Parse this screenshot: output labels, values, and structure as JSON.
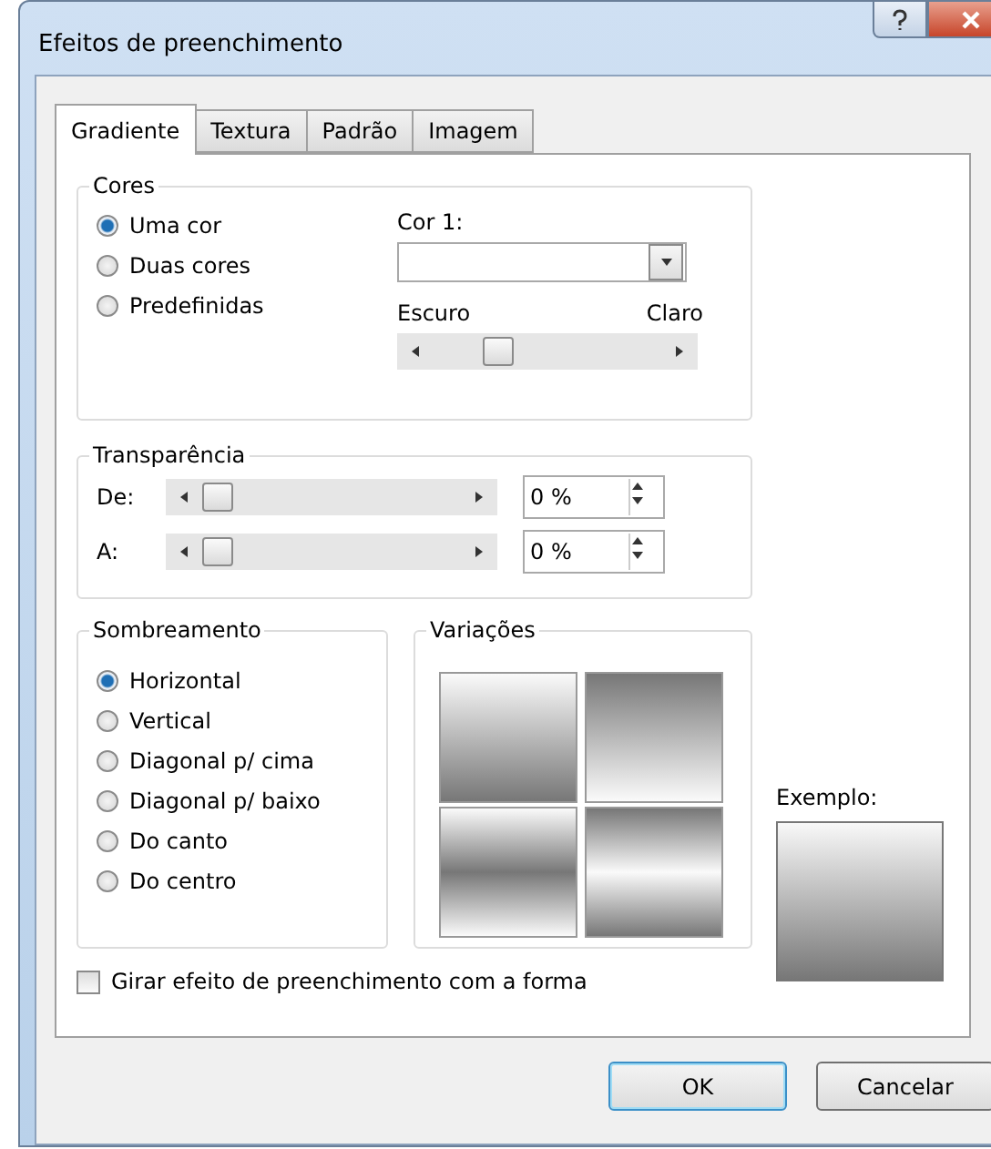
{
  "window": {
    "title": "Efeitos de preenchimento"
  },
  "tabs": [
    {
      "label": "Gradiente",
      "selected": true
    },
    {
      "label": "Textura",
      "selected": false
    },
    {
      "label": "Padrão",
      "selected": false
    },
    {
      "label": "Imagem",
      "selected": false
    }
  ],
  "cores": {
    "title": "Cores",
    "options": [
      {
        "label": "Uma cor",
        "selected": true
      },
      {
        "label": "Duas cores",
        "selected": false
      },
      {
        "label": "Predefinidas",
        "selected": false
      }
    ],
    "color_label": "Cor 1:",
    "dark_label": "Escuro",
    "light_label": "Claro",
    "level": 0.25
  },
  "transparencia": {
    "title": "Transparência",
    "rows": [
      {
        "label": "De:",
        "level": 0,
        "value": "0 %"
      },
      {
        "label": "A:",
        "level": 0,
        "value": "0 %"
      }
    ]
  },
  "sombreamento": {
    "title": "Sombreamento",
    "options": [
      {
        "label": "Horizontal",
        "selected": true
      },
      {
        "label": "Vertical",
        "selected": false
      },
      {
        "label": "Diagonal p/ cima",
        "selected": false
      },
      {
        "label": "Diagonal p/ baixo",
        "selected": false
      },
      {
        "label": "Do canto",
        "selected": false
      },
      {
        "label": "Do centro",
        "selected": false
      }
    ]
  },
  "variacoes": {
    "title": "Variações"
  },
  "exemplo": {
    "label": "Exemplo:"
  },
  "rotate": {
    "label": "Girar efeito de preenchimento com a forma",
    "checked": false
  },
  "buttons": [
    {
      "label": "OK",
      "default": true
    },
    {
      "label": "Cancelar",
      "default": false
    }
  ]
}
